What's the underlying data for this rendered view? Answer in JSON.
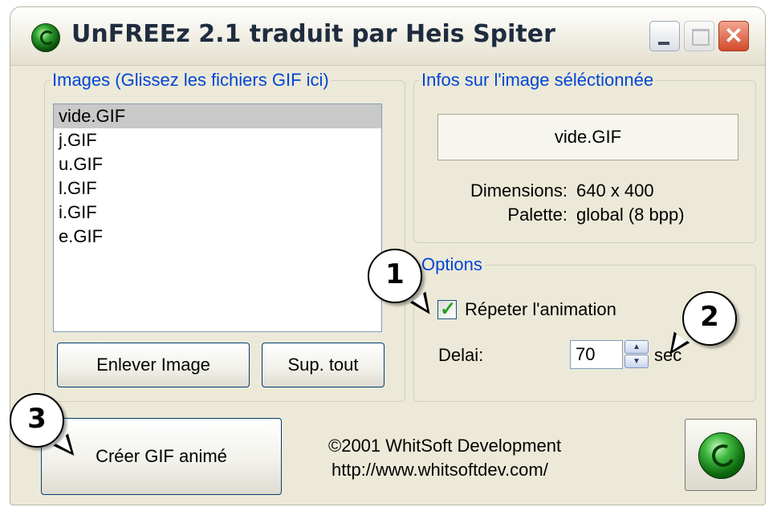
{
  "window": {
    "title": "UnFREEz 2.1 traduit par Heis Spiter",
    "close_glyph": "✕"
  },
  "images_group": {
    "legend": "Images (Glissez les fichiers GIF ici)",
    "files": [
      "vide.GIF",
      "j.GIF",
      "u.GIF",
      "l.GIF",
      "i.GIF",
      "e.GIF"
    ],
    "selected": "vide.GIF",
    "remove_button": "Enlever Image",
    "remove_all_button": "Sup. tout"
  },
  "info_group": {
    "legend": "Infos sur l'image séléctionnée",
    "filename": "vide.GIF",
    "dimensions_label": "Dimensions:",
    "dimensions_value": "640 x 400",
    "palette_label": "Palette:",
    "palette_value": "global (8 bpp)"
  },
  "options_group": {
    "legend": "Options",
    "repeat_label": "Répeter l'animation",
    "repeat_checked": true,
    "delay_label": "Delai:",
    "delay_value": "70",
    "delay_unit": "sec"
  },
  "footer": {
    "create_button": "Créer GIF animé",
    "copyright": "©2001 WhitSoft Development",
    "url": "http://www.whitsoftdev.com/"
  },
  "callouts": [
    "1",
    "2",
    "3"
  ],
  "colors": {
    "legend_blue": "#0046d5",
    "selection_gray": "#c9c9c9",
    "check_green": "#21a121",
    "close_red": "#d24a2c"
  },
  "icons": [
    "app-logo-icon",
    "minimize-icon",
    "maximize-icon",
    "close-icon",
    "spin-up-icon",
    "spin-down-icon",
    "whitsoft-logo-icon"
  ]
}
